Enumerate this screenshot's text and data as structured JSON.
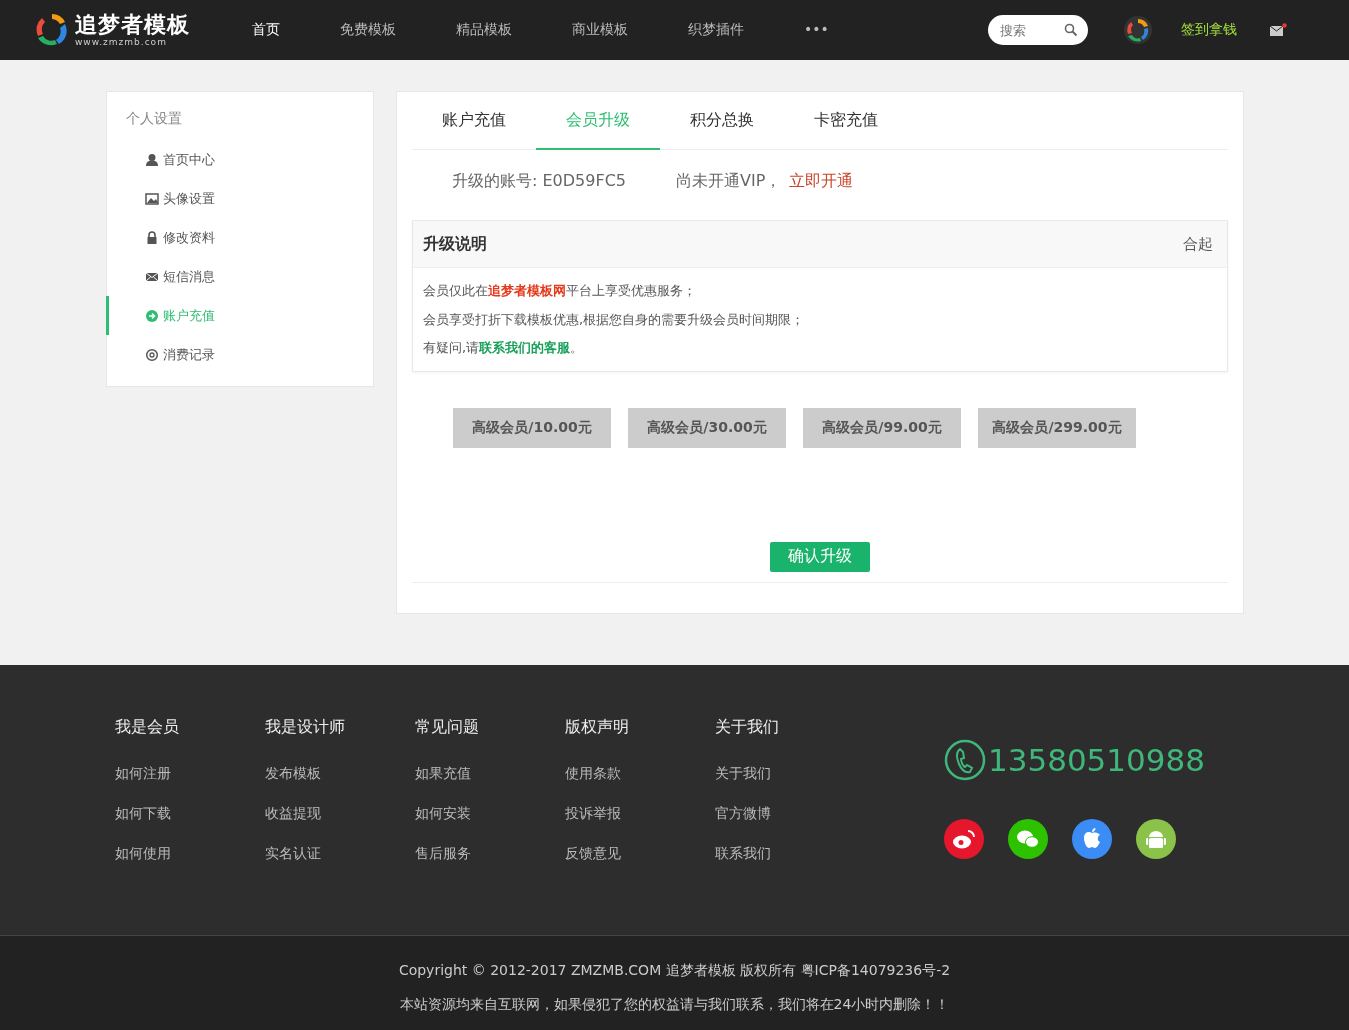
{
  "header": {
    "logo": {
      "name": "追梦者模板",
      "url": "www.zmzmb.com"
    },
    "nav": [
      {
        "label": "首页",
        "selected": true
      },
      {
        "label": "免费模板",
        "selected": false
      },
      {
        "label": "精品模板",
        "selected": false
      },
      {
        "label": "商业模板",
        "selected": false
      },
      {
        "label": "织梦插件",
        "selected": false
      },
      {
        "label": "•••",
        "selected": false
      }
    ],
    "search": {
      "placeholder": "搜索"
    },
    "signin": "签到拿钱"
  },
  "sidebar": {
    "title": "个人设置",
    "items": [
      {
        "label": "首页中心",
        "selected": false
      },
      {
        "label": "头像设置",
        "selected": false
      },
      {
        "label": "修改资料",
        "selected": false
      },
      {
        "label": "短信消息",
        "selected": false
      },
      {
        "label": "账户充值",
        "selected": true
      },
      {
        "label": "消费记录",
        "selected": false
      }
    ]
  },
  "main": {
    "tabs": [
      {
        "label": "账户充值",
        "selected": false
      },
      {
        "label": "会员升级",
        "selected": true
      },
      {
        "label": "积分总换",
        "selected": false
      },
      {
        "label": "卡密充值",
        "selected": false
      }
    ],
    "account": "升级的账号: E0D59FC5",
    "vip_status": "尚未开通VIP，",
    "vip_link": "立即开通",
    "panel": {
      "title": "升级说明",
      "toggle": "合起",
      "lines": [
        {
          "parts": [
            {
              "text": "会员仅此在",
              "kind": "plain"
            },
            {
              "text": "追梦者模板网",
              "kind": "brand"
            },
            {
              "text": "平台上享受优惠服务；",
              "kind": "plain"
            }
          ]
        },
        {
          "parts": [
            {
              "text": "会员享受打折下载模板优惠,根据您自身的需要升级会员时间期限；",
              "kind": "plain"
            }
          ]
        },
        {
          "parts": [
            {
              "text": "有疑问,请",
              "kind": "plain"
            },
            {
              "text": "联系我们的客服",
              "kind": "link"
            },
            {
              "text": "。",
              "kind": "plain"
            }
          ]
        }
      ]
    },
    "plans": [
      {
        "label": "高级会员/10.00元",
        "selected": false
      },
      {
        "label": "高级会员/30.00元",
        "selected": false
      },
      {
        "label": "高级会员/99.00元",
        "selected": false
      },
      {
        "label": "高级会员/299.00元",
        "selected": false
      }
    ],
    "confirm": "确认升级"
  },
  "footer": {
    "columns": [
      {
        "title": "我是会员",
        "links": [
          "如何注册",
          "如何下载",
          "如何使用"
        ]
      },
      {
        "title": "我是设计师",
        "links": [
          "发布模板",
          "收益提现",
          "实名认证"
        ]
      },
      {
        "title": "常见问题",
        "links": [
          "如果充值",
          "如何安装",
          "售后服务"
        ]
      },
      {
        "title": "版权声明",
        "links": [
          "使用条款",
          "投诉举报",
          "反馈意见"
        ]
      },
      {
        "title": "关于我们",
        "links": [
          "关于我们",
          "官方微博",
          "联系我们"
        ]
      }
    ],
    "phone": "13580510988",
    "copyright": "Copyright © 2012-2017 ZMZMB.COM 追梦者模板 版权所有 粤ICP备14079236号-2",
    "notice": "本站资源均来自互联网，如果侵犯了您的权益请与我们联系，我们将在24小时内删除！！"
  }
}
